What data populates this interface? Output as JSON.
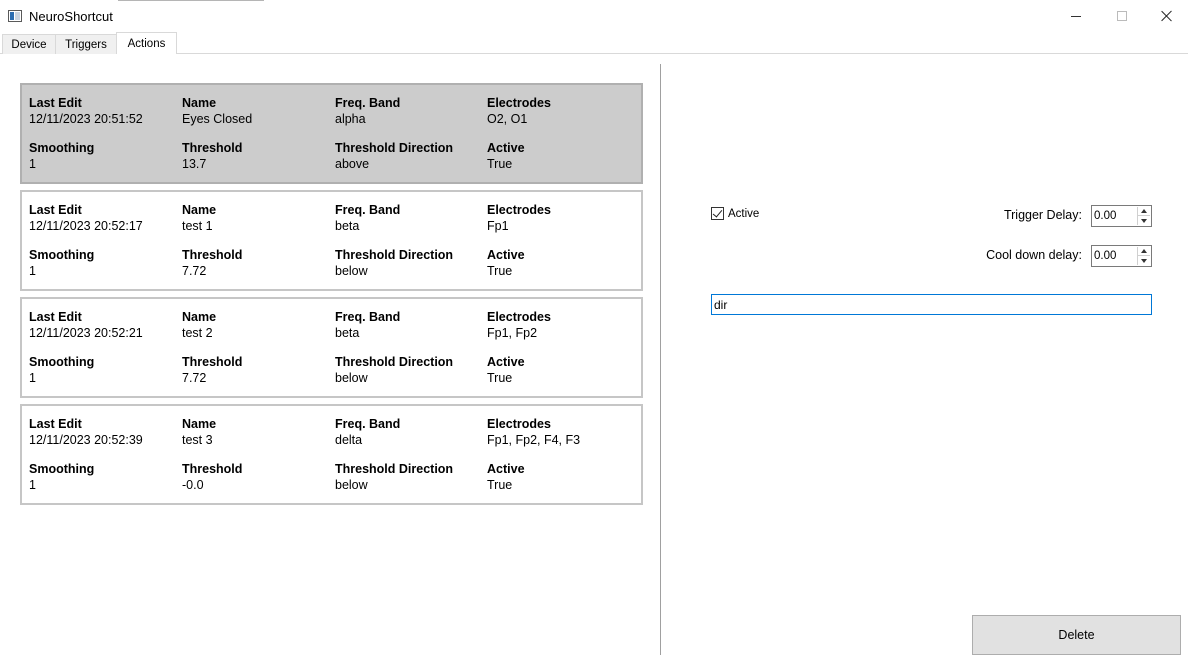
{
  "window": {
    "title": "NeuroShortcut",
    "icon": "app-window-icon"
  },
  "tabs": [
    {
      "label": "Device",
      "active": false
    },
    {
      "label": "Triggers",
      "active": false
    },
    {
      "label": "Actions",
      "active": true
    }
  ],
  "field_labels": {
    "last_edit": "Last Edit",
    "name": "Name",
    "freq_band": "Freq. Band",
    "electrodes": "Electrodes",
    "smoothing": "Smoothing",
    "threshold": "Threshold",
    "threshold_direction": "Threshold Direction",
    "active": "Active"
  },
  "actions": [
    {
      "last_edit": "12/11/2023 20:51:52",
      "name": "Eyes Closed",
      "freq_band": "alpha",
      "electrodes": "O2, O1",
      "smoothing": "1",
      "threshold": "13.7",
      "threshold_direction": "above",
      "active": "True",
      "selected": true
    },
    {
      "last_edit": "12/11/2023 20:52:17",
      "name": "test 1",
      "freq_band": "beta",
      "electrodes": "Fp1",
      "smoothing": "1",
      "threshold": "7.72",
      "threshold_direction": "below",
      "active": "True",
      "selected": false
    },
    {
      "last_edit": "12/11/2023 20:52:21",
      "name": "test 2",
      "freq_band": "beta",
      "electrodes": "Fp1, Fp2",
      "smoothing": "1",
      "threshold": "7.72",
      "threshold_direction": "below",
      "active": "True",
      "selected": false
    },
    {
      "last_edit": "12/11/2023 20:52:39",
      "name": "test 3",
      "freq_band": "delta",
      "electrodes": "Fp1, Fp2, F4, F3",
      "smoothing": "1",
      "threshold": "-0.0",
      "threshold_direction": "below",
      "active": "True",
      "selected": false
    }
  ],
  "editor": {
    "active_label": "Active",
    "active_checked": true,
    "trigger_delay_label": "Trigger Delay:",
    "trigger_delay_value": "0.00",
    "cooldown_label": "Cool down delay:",
    "cooldown_value": "0.00",
    "command_value": "dir",
    "delete_label": "Delete"
  }
}
